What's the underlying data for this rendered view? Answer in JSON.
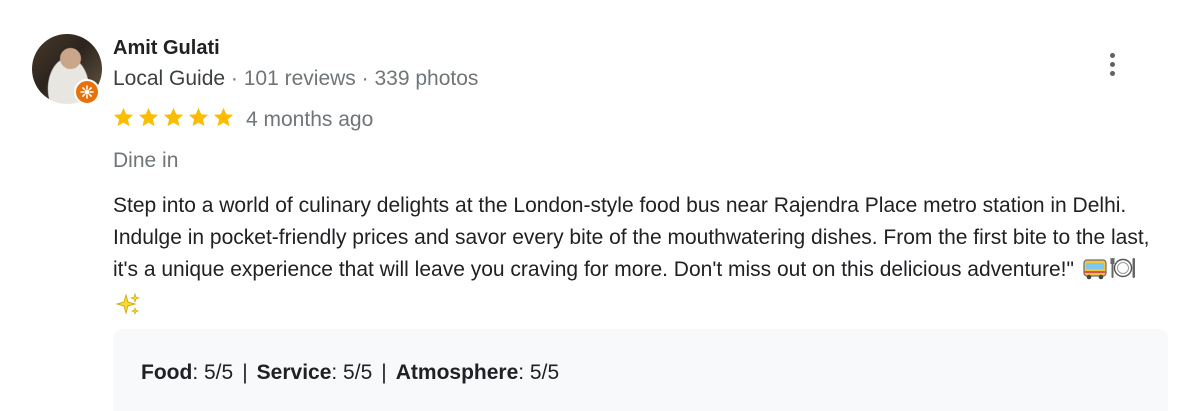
{
  "reviewer": {
    "name": "Amit Gulati",
    "guide_label": "Local Guide",
    "separator": " · ",
    "reviews": "101 reviews",
    "photos": "339 photos"
  },
  "review": {
    "rating": 5,
    "rating_max": 5,
    "date": "4 months ago",
    "mode": "Dine in",
    "text": "Step into a world of culinary delights at the London-style food bus near Rajendra Place metro station in Delhi. Indulge in pocket-friendly prices and savor every bite of the mouthwatering dishes. From the first bite to the last, it's a unique experience that will leave you craving for more. Don't miss out on this delicious adventure!\"",
    "emojis": [
      "bus-emoji",
      "plate-cutlery-emoji",
      "sparkles-emoji"
    ]
  },
  "ratings": {
    "food_label": "Food",
    "food_value": ": 5/5",
    "service_label": "Service",
    "service_value": ": 5/5",
    "atmosphere_label": "Atmosphere",
    "atmosphere_value": ": 5/5",
    "divider": "|"
  },
  "colors": {
    "star": "#fbbc04",
    "badge": "#e8710a",
    "secondary_text": "#70757a",
    "box_background": "#f8f9fa"
  },
  "icons": {
    "more": "more-vert-icon",
    "badge": "local-guide-badge-icon",
    "star": "star-icon"
  }
}
